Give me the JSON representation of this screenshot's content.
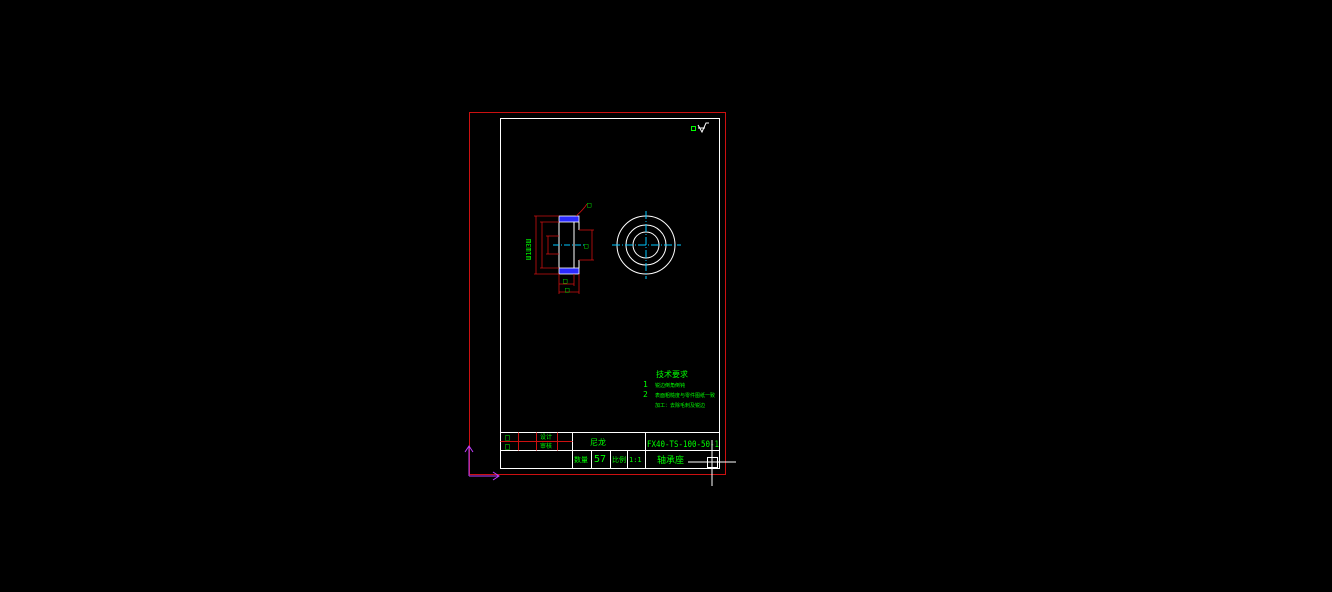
{
  "colors": {
    "background": "#000000",
    "sheet_border": "#cc1010",
    "frame": "#ffffff",
    "annotation": "#00ff00",
    "center_line": "#00c8ff",
    "hatch": "#2a2aff",
    "ucs": "#c040ff",
    "cursor": "#ffffff"
  },
  "drawing": {
    "dimension_labels": {
      "diameter_stack": "Ш1Ш3Ш",
      "leader_tag": "□",
      "right_tag": "□",
      "bottom_tag_1": "□",
      "bottom_tag_2": "□"
    },
    "surface_finish_symbol": "□∀",
    "technical_requirements": {
      "heading": "技术要求",
      "line_1_number": "1",
      "line_1_text": "锐边倒角倒钝",
      "line_2_number": "2",
      "line_2_text": "表面粗糙度与零件图纸一致",
      "line_3_text": "加工：去除毛刺及锐边"
    }
  },
  "title_block": {
    "drawing_number": "FX40-TS-100-50-1",
    "part_name": "轴承座",
    "material_label": "尼龙",
    "quantity_label": "数量",
    "quantity_value": "57",
    "scale_label": "比例",
    "scale_value": "1:1",
    "designer_label": "设计",
    "checker_label": "审核",
    "left_cell_1": "□",
    "left_cell_2": "□"
  }
}
